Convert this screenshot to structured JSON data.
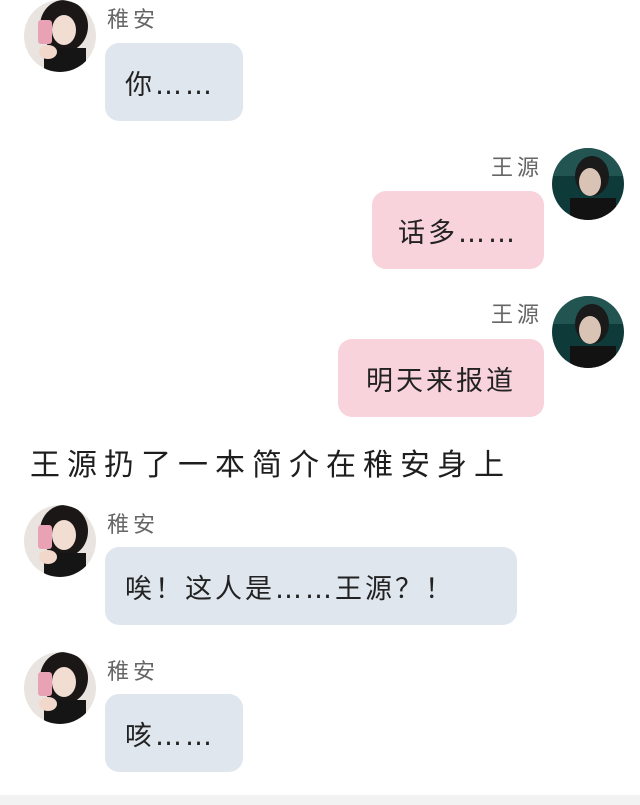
{
  "characters": {
    "zhi_an": "稚安",
    "wang_yuan": "王源"
  },
  "messages": [
    {
      "sender": "稚安",
      "text": "你……"
    },
    {
      "sender": "王源",
      "text": "话多……"
    },
    {
      "sender": "王源",
      "text": "明天来报道"
    },
    {
      "narration": "王源扔了一本简介在稚安身上"
    },
    {
      "sender": "稚安",
      "text": "唉！这人是……王源？！"
    },
    {
      "sender": "稚安",
      "text": "咳……"
    }
  ],
  "colors": {
    "left_bubble": "#dfe6ee",
    "right_bubble": "#f8d3dc",
    "background": "#ffffff"
  }
}
